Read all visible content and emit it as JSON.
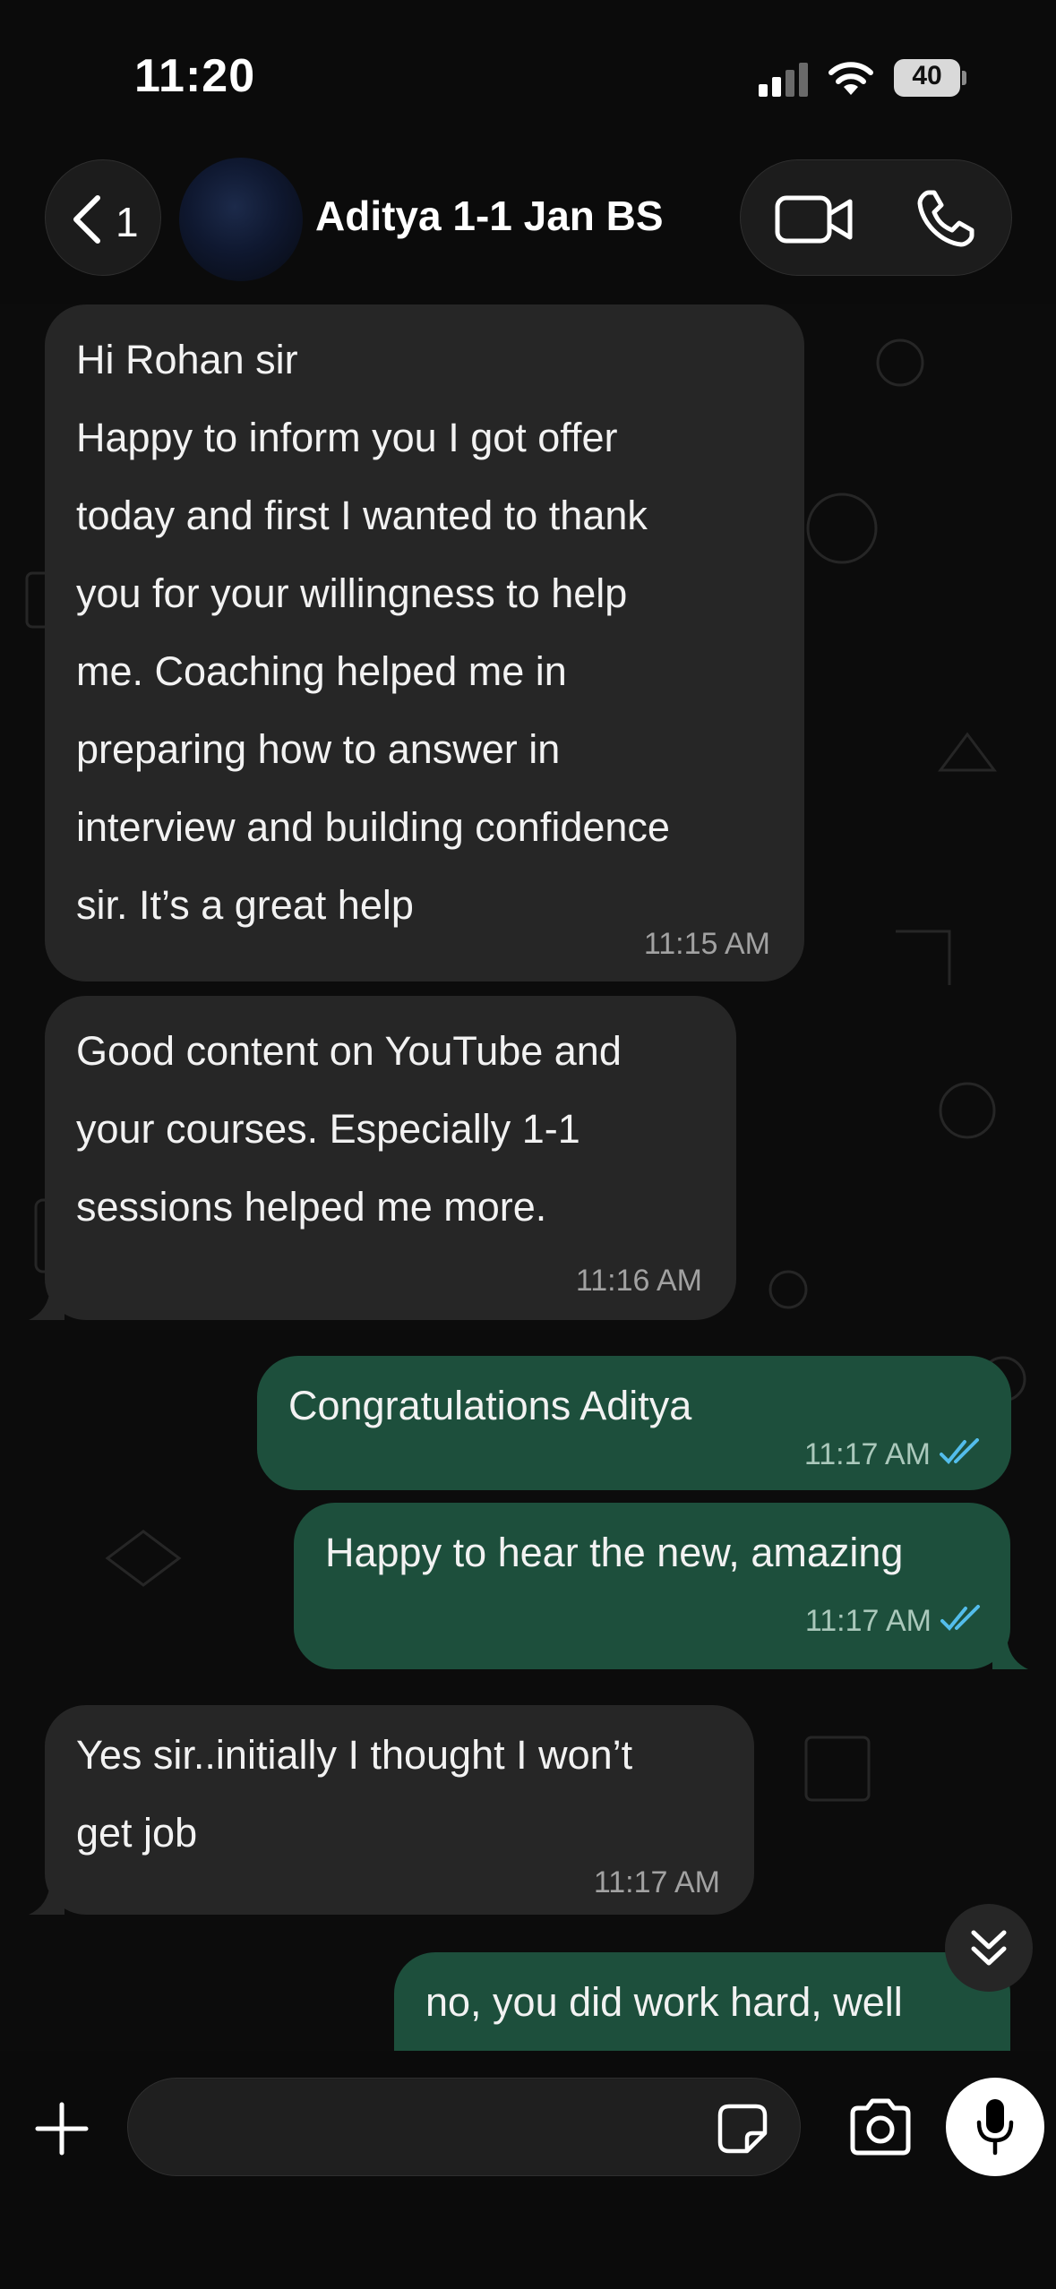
{
  "status_bar": {
    "time": "11:20",
    "battery": "40"
  },
  "header": {
    "back_count": "1",
    "contact_name": "Aditya 1-1 Jan BS"
  },
  "messages": [
    {
      "direction": "in",
      "text": "Hi Rohan sir\nHappy to inform you I got offer\ntoday and first I wanted to thank\nyou for your willingness to help\nme. Coaching helped me in\npreparing how to answer in\ninterview and building confidence\nsir. It’s a great help",
      "time": "11:15 AM"
    },
    {
      "direction": "in",
      "text": "Good content on YouTube and\nyour courses. Especially 1-1\nsessions helped me more.",
      "time": "11:16 AM"
    },
    {
      "direction": "out",
      "text": "Congratulations Aditya",
      "time": "11:17 AM",
      "status": "read"
    },
    {
      "direction": "out",
      "text": "Happy to hear the new, amazing",
      "time": "11:17 AM",
      "status": "read"
    },
    {
      "direction": "in",
      "text": "Yes sir..initially I thought I won’t\nget job",
      "time": "11:17 AM"
    },
    {
      "direction": "out",
      "text": "no, you did work hard, well",
      "time": "",
      "status": ""
    }
  ],
  "input": {
    "value": "",
    "placeholder": ""
  },
  "icons": {
    "signal": "signal-icon",
    "wifi": "wifi-icon",
    "back": "chevron-left-icon",
    "video": "video-camera-icon",
    "phone": "phone-icon",
    "scroll": "double-chevron-down-icon",
    "plus": "plus-icon",
    "sticker": "sticker-icon",
    "camera": "camera-icon",
    "mic": "microphone-icon",
    "read_ticks": "double-check-icon"
  },
  "colors": {
    "background": "#0b0b0b",
    "incoming_bubble": "#262626",
    "outgoing_bubble": "#1d4f3c",
    "read_ticks": "#53bdeb",
    "time_text": "#a2a2a2"
  }
}
